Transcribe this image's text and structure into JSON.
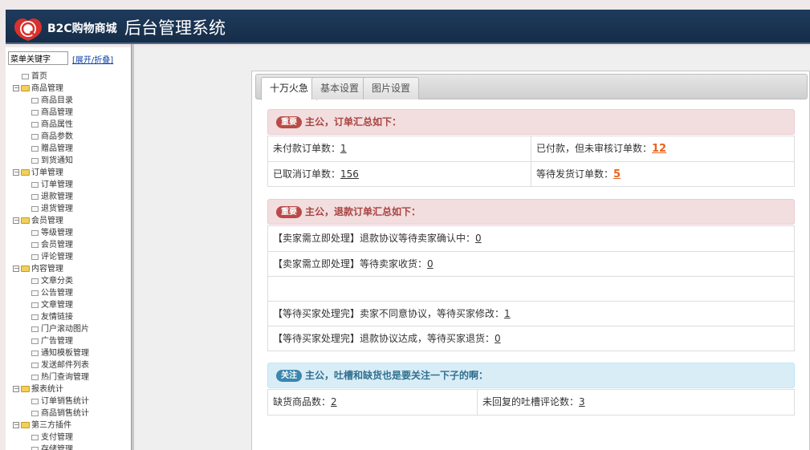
{
  "header": {
    "logo_text": "B2C购物商城",
    "title": "后台管理系统",
    "accent": "#152c47"
  },
  "sidebar": {
    "search_value": "菜单关键字",
    "toggle_label": "[展开/折叠]",
    "tree": [
      {
        "label": "首页",
        "kind": "leaf0"
      },
      {
        "label": "商品管理",
        "kind": "folder"
      },
      {
        "label": "商品目录",
        "kind": "item"
      },
      {
        "label": "商品管理",
        "kind": "item"
      },
      {
        "label": "商品属性",
        "kind": "item"
      },
      {
        "label": "商品参数",
        "kind": "item"
      },
      {
        "label": "赠品管理",
        "kind": "item"
      },
      {
        "label": "到货通知",
        "kind": "item"
      },
      {
        "label": "订单管理",
        "kind": "folder"
      },
      {
        "label": "订单管理",
        "kind": "item"
      },
      {
        "label": "退款管理",
        "kind": "item"
      },
      {
        "label": "退货管理",
        "kind": "item"
      },
      {
        "label": "会员管理",
        "kind": "folder"
      },
      {
        "label": "等级管理",
        "kind": "item"
      },
      {
        "label": "会员管理",
        "kind": "item"
      },
      {
        "label": "评论管理",
        "kind": "item"
      },
      {
        "label": "内容管理",
        "kind": "folder"
      },
      {
        "label": "文章分类",
        "kind": "item"
      },
      {
        "label": "公告管理",
        "kind": "item"
      },
      {
        "label": "文章管理",
        "kind": "item"
      },
      {
        "label": "友情链接",
        "kind": "item"
      },
      {
        "label": "门户滚动图片",
        "kind": "item"
      },
      {
        "label": "广告管理",
        "kind": "item"
      },
      {
        "label": "通知模板管理",
        "kind": "item"
      },
      {
        "label": "发送邮件列表",
        "kind": "item"
      },
      {
        "label": "热门查询管理",
        "kind": "item"
      },
      {
        "label": "报表统计",
        "kind": "folder"
      },
      {
        "label": "订单销售统计",
        "kind": "item"
      },
      {
        "label": "商品销售统计",
        "kind": "item"
      },
      {
        "label": "第三方插件",
        "kind": "folder"
      },
      {
        "label": "支付管理",
        "kind": "item"
      },
      {
        "label": "存储管理",
        "kind": "item"
      }
    ]
  },
  "tabs": [
    {
      "label": "十万火急",
      "active": true
    },
    {
      "label": "基本设置",
      "active": false
    },
    {
      "label": "图片设置",
      "active": false
    }
  ],
  "orders": {
    "badge": "重要",
    "heading": "主公，订单汇总如下：",
    "unpaid_label": "未付款订单数：",
    "unpaid_value": "1",
    "paid_unreviewed_label": "已付款，但未审核订单数：",
    "paid_unreviewed_value": "12",
    "cancelled_label": "已取消订单数：",
    "cancelled_value": "156",
    "await_ship_label": "等待发货订单数：",
    "await_ship_value": "5"
  },
  "refunds": {
    "badge": "重要",
    "heading": "主公，退款订单汇总如下：",
    "rows": [
      {
        "label": "【卖家需立即处理】退款协议等待卖家确认中：",
        "value": "0"
      },
      {
        "label": "【卖家需立即处理】等待卖家收货：",
        "value": "0"
      },
      {
        "label": "",
        "value": ""
      },
      {
        "label": "【等待买家处理完】卖家不同意协议，等待买家修改：",
        "value": "1"
      },
      {
        "label": "【等待买家处理完】退款协议达成，等待买家退货：",
        "value": "0"
      }
    ]
  },
  "stock": {
    "badge": "关注",
    "heading": "主公，吐槽和缺货也是要关注一下子的啊：",
    "out_of_stock_label": "缺货商品数：",
    "out_of_stock_value": "2",
    "unreplied_label": "未回复的吐槽评论数：",
    "unreplied_value": "3"
  }
}
